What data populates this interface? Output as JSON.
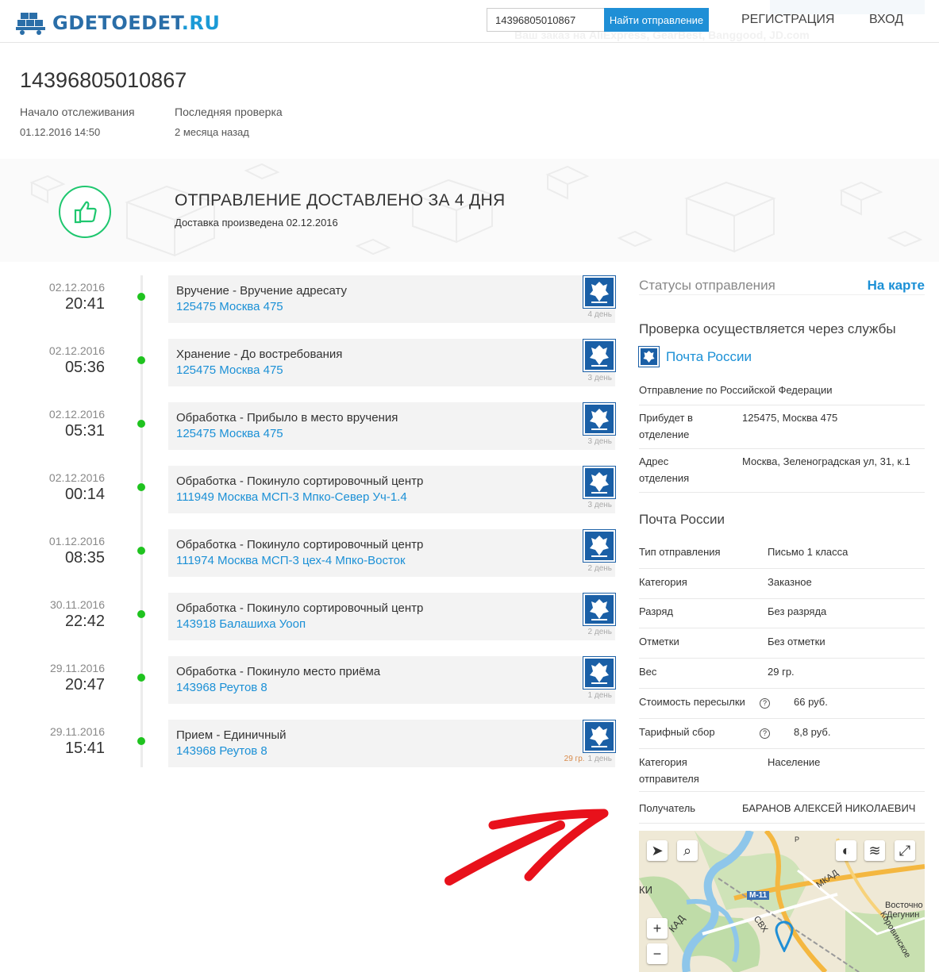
{
  "header": {
    "logo_text": "GDETOEDET",
    "logo_domain": ".RU",
    "search_value": "14396805010867",
    "search_button": "Найти отправление",
    "register": "РЕГИСТРАЦИЯ",
    "login": "ВХОД",
    "ghost_text": "Ваш заказ на AliExpress, GearBest, Banggood, JD.com"
  },
  "tracking": {
    "number": "14396805010867",
    "start_label": "Начало отслеживания",
    "start_value": "01.12.2016 14:50",
    "last_label": "Последняя проверка",
    "last_value": "2 месяца назад"
  },
  "status": {
    "title": "ОТПРАВЛЕНИЕ ДОСТАВЛЕНО ЗА 4 ДНЯ",
    "subtitle": "Доставка произведена 02.12.2016"
  },
  "timeline": [
    {
      "date": "02.12.2016",
      "time": "20:41",
      "title": "Вручение - Вручение адресату",
      "place": "125475 Москва 475",
      "days": "4 день",
      "weight": ""
    },
    {
      "date": "02.12.2016",
      "time": "05:36",
      "title": "Хранение - До востребования",
      "place": "125475 Москва 475",
      "days": "3 день",
      "weight": ""
    },
    {
      "date": "02.12.2016",
      "time": "05:31",
      "title": "Обработка - Прибыло в место вручения",
      "place": "125475 Москва 475",
      "days": "3 день",
      "weight": ""
    },
    {
      "date": "02.12.2016",
      "time": "00:14",
      "title": "Обработка - Покинуло сортировочный центр",
      "place": "111949 Москва МСП-3 Мпко-Север Уч-1.4",
      "days": "3 день",
      "weight": ""
    },
    {
      "date": "01.12.2016",
      "time": "08:35",
      "title": "Обработка - Покинуло сортировочный центр",
      "place": "111974 Москва МСП-3 цех-4 Мпко-Восток",
      "days": "2 день",
      "weight": ""
    },
    {
      "date": "30.11.2016",
      "time": "22:42",
      "title": "Обработка - Покинуло сортировочный центр",
      "place": "143918 Балашиха Уооп",
      "days": "2 день",
      "weight": ""
    },
    {
      "date": "29.11.2016",
      "time": "20:47",
      "title": "Обработка - Покинуло место приёма",
      "place": "143968 Реутов 8",
      "days": "1 день",
      "weight": ""
    },
    {
      "date": "29.11.2016",
      "time": "15:41",
      "title": "Прием - Единичный",
      "place": "143968 Реутов 8",
      "days": "1 день",
      "weight": "29 гр."
    }
  ],
  "sidebar": {
    "statuses_title": "Статусы отправления",
    "on_map": "На карте",
    "services_title": "Проверка осуществляется через службы",
    "service_name": "Почта России",
    "shipment_note": "Отправление по Российской Федерации",
    "arrive_label": "Прибудет в отделение",
    "arrive_value": "125475, Москва 475",
    "address_label": "Адрес отделения",
    "address_value": "Москва, Зеленоградская ул, 31, к.1",
    "section2_title": "Почта России",
    "rows": [
      {
        "k": "Тип отправления",
        "v": "Письмо 1 класса"
      },
      {
        "k": "Категория",
        "v": "Заказное"
      },
      {
        "k": "Разряд",
        "v": "Без разряда"
      },
      {
        "k": "Отметки",
        "v": "Без отметки"
      },
      {
        "k": "Вес",
        "v": "29 гр."
      }
    ],
    "cost_label": "Стоимость пересылки",
    "cost_value": "66 руб.",
    "fee_label": "Тарифный сбор",
    "fee_value": "8,8 руб.",
    "sender_cat_label": "Категория отправителя",
    "sender_cat_value": "Население",
    "recipient_label": "Получатель",
    "recipient_value": "БАРАНОВ АЛЕКСЕЙ НИКОЛАЕВИЧ",
    "help_glyph": "?"
  },
  "map": {
    "label_mkad": "МКАД",
    "label_m11": "М-11",
    "label_kad": "КАД",
    "label_ki": "КИ",
    "label_vostochnoe": "Восточно",
    "label_degunino": "Дегунин",
    "label_svh": "СВХ",
    "label_korovinskoe": "Коровинское",
    "label_r": "Р",
    "plus": "+",
    "minus": "−"
  }
}
